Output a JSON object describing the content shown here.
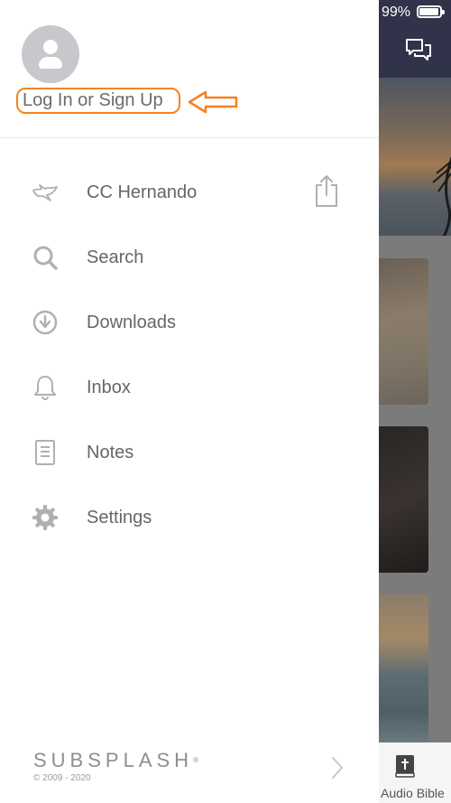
{
  "status_bar": {
    "battery": "99%"
  },
  "drawer": {
    "login_label": "Log In or Sign Up",
    "menu": [
      {
        "label": "CC Hernando",
        "icon": "dove-icon"
      },
      {
        "label": "Search",
        "icon": "search-icon"
      },
      {
        "label": "Downloads",
        "icon": "download-icon"
      },
      {
        "label": "Inbox",
        "icon": "bell-icon"
      },
      {
        "label": "Notes",
        "icon": "notes-icon"
      },
      {
        "label": "Settings",
        "icon": "gear-icon"
      }
    ],
    "footer": {
      "brand": "SUBSPLASH",
      "brand_mark": "®",
      "copyright": "© 2009 - 2020"
    }
  },
  "background": {
    "tab_label": "Audio Bible"
  },
  "colors": {
    "accent_annotation": "#f58220",
    "header_bg": "#303349",
    "icon_gray": "#b0b0b0"
  }
}
